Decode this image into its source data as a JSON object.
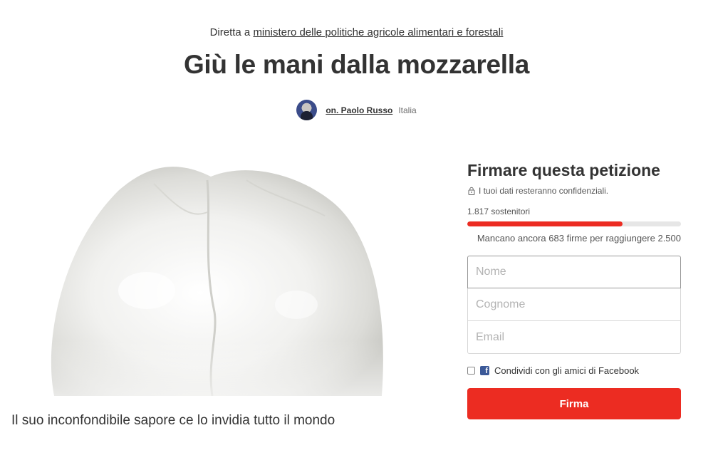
{
  "header": {
    "directed_prefix": "Diretta a",
    "directed_target": "ministero delle politiche agricole alimentari e forestali",
    "title": "Giù le mani dalla mozzarella",
    "author_name": "on. Paolo Russo",
    "author_location": "Italia"
  },
  "hero": {
    "caption": "Il suo inconfondibile sapore ce lo invidia tutto il mondo"
  },
  "sign_panel": {
    "title": "Firmare questa petizione",
    "privacy_note": "I tuoi dati resteranno confidenziali.",
    "supporters": "1.817 sostenitori",
    "progress_fraction": 0.727,
    "remaining": "Mancano ancora 683 firme per raggiungere 2.500",
    "fields": {
      "first_name_placeholder": "Nome",
      "last_name_placeholder": "Cognome",
      "email_placeholder": "Email"
    },
    "share_label": "Condividi con gli amici di Facebook",
    "submit_label": "Firma"
  },
  "colors": {
    "accent": "#ec2c22",
    "facebook": "#3b5998",
    "progress_track": "#e6e6e6"
  },
  "icons": [
    "lock-icon",
    "facebook-icon",
    "avatar"
  ]
}
